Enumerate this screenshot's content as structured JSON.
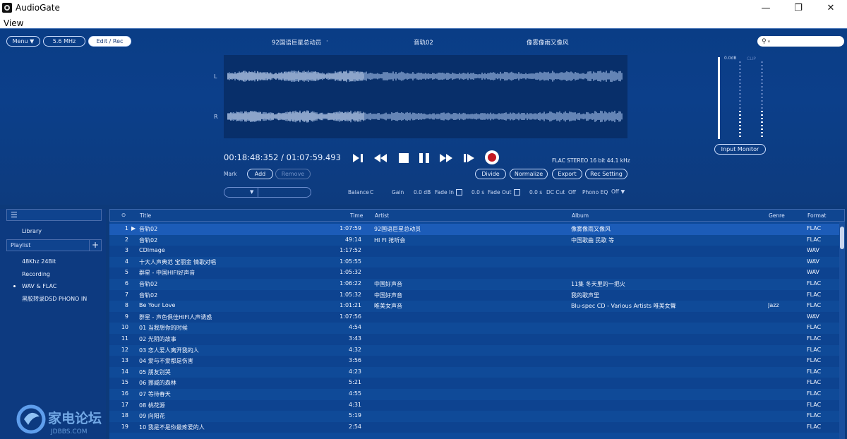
{
  "window": {
    "title": "AudioGate",
    "minimize": "—",
    "maximize": "❐",
    "close": "✕"
  },
  "menubar": {
    "view": "View"
  },
  "toolbar": {
    "menu": "Menu ▼",
    "rate": "5.6 MHz",
    "mode": "Edit / Rec"
  },
  "now_playing": {
    "artist": "92国语巨星总动员",
    "title": "音轨02",
    "album": "像雾像雨又像风"
  },
  "search": {
    "placeholder": ""
  },
  "waveform": {
    "left_label": "L",
    "right_label": "R"
  },
  "transport": {
    "time": "00:18:48:352 / 01:07:59.493",
    "format": "FLAC STEREO 16 bit 44.1 kHz"
  },
  "edit_buttons": {
    "divide": "Divide",
    "normalize": "Normalize",
    "export": "Export",
    "rec_setting": "Rec Setting"
  },
  "mark": {
    "label": "Mark",
    "add": "Add",
    "remove": "Remove"
  },
  "params": {
    "balance_label": "Balance",
    "balance_value": "C",
    "gain_label": "Gain",
    "gain_value": "0.0 dB",
    "fade_in_label": "Fade In",
    "fade_in_value": "0.0 s",
    "fade_out_label": "Fade Out",
    "fade_out_value": "0.0 s",
    "dc_cut_label": "DC Cut",
    "dc_cut_value": "Off",
    "phono_eq_label": "Phono EQ",
    "phono_eq_value": "Off ▼"
  },
  "meter": {
    "top_label": "0.0dB",
    "clip_label": "CLIP",
    "input_monitor": "Input Monitor"
  },
  "sidebar": {
    "head": "☰",
    "library": "Library",
    "playlist": "Playlist",
    "plus": "+",
    "items": [
      "48Khz 24Bit",
      "Recording",
      "WAV & FLAC",
      "黑胶转录DSD PHONO IN"
    ]
  },
  "table": {
    "headers": {
      "num": "⊙",
      "title": "Title",
      "time": "Time",
      "artist": "Artist",
      "album": "Album",
      "genre": "Genre",
      "format": "Format"
    },
    "rows": [
      {
        "n": "1",
        "play": "▶",
        "title": "音轨02",
        "time": "1:07:59",
        "artist": "92国语巨星总动员",
        "album": "像雾像雨又像风",
        "genre": "",
        "format": "FLAC"
      },
      {
        "n": "2",
        "play": "",
        "title": "音轨02",
        "time": "49:14",
        "artist": "HI FI 抢听会",
        "album": "中国歌曲 民歌 等",
        "genre": "",
        "format": "FLAC"
      },
      {
        "n": "3",
        "play": "",
        "title": "CDImage",
        "time": "1:17:52",
        "artist": "",
        "album": "",
        "genre": "",
        "format": "WAV"
      },
      {
        "n": "4",
        "play": "",
        "title": "十大人声典范 宝丽金 情歌对唱",
        "time": "1:05:55",
        "artist": "",
        "album": "",
        "genre": "",
        "format": "WAV"
      },
      {
        "n": "5",
        "play": "",
        "title": "群星 - 中国HIFI好声音",
        "time": "1:05:32",
        "artist": "",
        "album": "",
        "genre": "",
        "format": "WAV"
      },
      {
        "n": "6",
        "play": "",
        "title": "音轨02",
        "time": "1:06:22",
        "artist": "中国好声音",
        "album": "11集 冬天里的一把火",
        "genre": "",
        "format": "FLAC"
      },
      {
        "n": "7",
        "play": "",
        "title": "音轨02",
        "time": "1:05:32",
        "artist": "中国好声音",
        "album": "我的歌声里",
        "genre": "",
        "format": "FLAC"
      },
      {
        "n": "8",
        "play": "",
        "title": "Be Your Love",
        "time": "1:01:21",
        "artist": "唯美女声音",
        "album": "Blu-spec CD - Various Artists 唯美女聲",
        "genre": "Jazz",
        "format": "FLAC"
      },
      {
        "n": "9",
        "play": "",
        "title": "群星 - 声色俱佳HIFI人声诱惑",
        "time": "1:07:56",
        "artist": "",
        "album": "",
        "genre": "",
        "format": "WAV"
      },
      {
        "n": "10",
        "play": "",
        "title": "01 当我想你的时候",
        "time": "4:54",
        "artist": "",
        "album": "",
        "genre": "",
        "format": "FLAC"
      },
      {
        "n": "11",
        "play": "",
        "title": "02 光阴的故事",
        "time": "3:43",
        "artist": "",
        "album": "",
        "genre": "",
        "format": "FLAC"
      },
      {
        "n": "12",
        "play": "",
        "title": "03 恋人爱人离开我的人",
        "time": "4:32",
        "artist": "",
        "album": "",
        "genre": "",
        "format": "FLAC"
      },
      {
        "n": "13",
        "play": "",
        "title": "04 爱与不爱都是伤害",
        "time": "3:56",
        "artist": "",
        "album": "",
        "genre": "",
        "format": "FLAC"
      },
      {
        "n": "14",
        "play": "",
        "title": "05 朋友别哭",
        "time": "4:23",
        "artist": "",
        "album": "",
        "genre": "",
        "format": "FLAC"
      },
      {
        "n": "15",
        "play": "",
        "title": "06 挪威的森林",
        "time": "5:21",
        "artist": "",
        "album": "",
        "genre": "",
        "format": "FLAC"
      },
      {
        "n": "16",
        "play": "",
        "title": "07 等待春天",
        "time": "4:55",
        "artist": "",
        "album": "",
        "genre": "",
        "format": "FLAC"
      },
      {
        "n": "17",
        "play": "",
        "title": "08 桃花源",
        "time": "4:31",
        "artist": "",
        "album": "",
        "genre": "",
        "format": "FLAC"
      },
      {
        "n": "18",
        "play": "",
        "title": "09 向阳花",
        "time": "5:19",
        "artist": "",
        "album": "",
        "genre": "",
        "format": "FLAC"
      },
      {
        "n": "19",
        "play": "",
        "title": "10 我是不是你最疼爱的人",
        "time": "2:54",
        "artist": "",
        "album": "",
        "genre": "",
        "format": "FLAC"
      }
    ]
  },
  "watermark": {
    "text": "家电论坛",
    "sub": "JDBBS.COM"
  },
  "colors": {
    "accent": "#0d3a7a",
    "record": "#c31923"
  }
}
